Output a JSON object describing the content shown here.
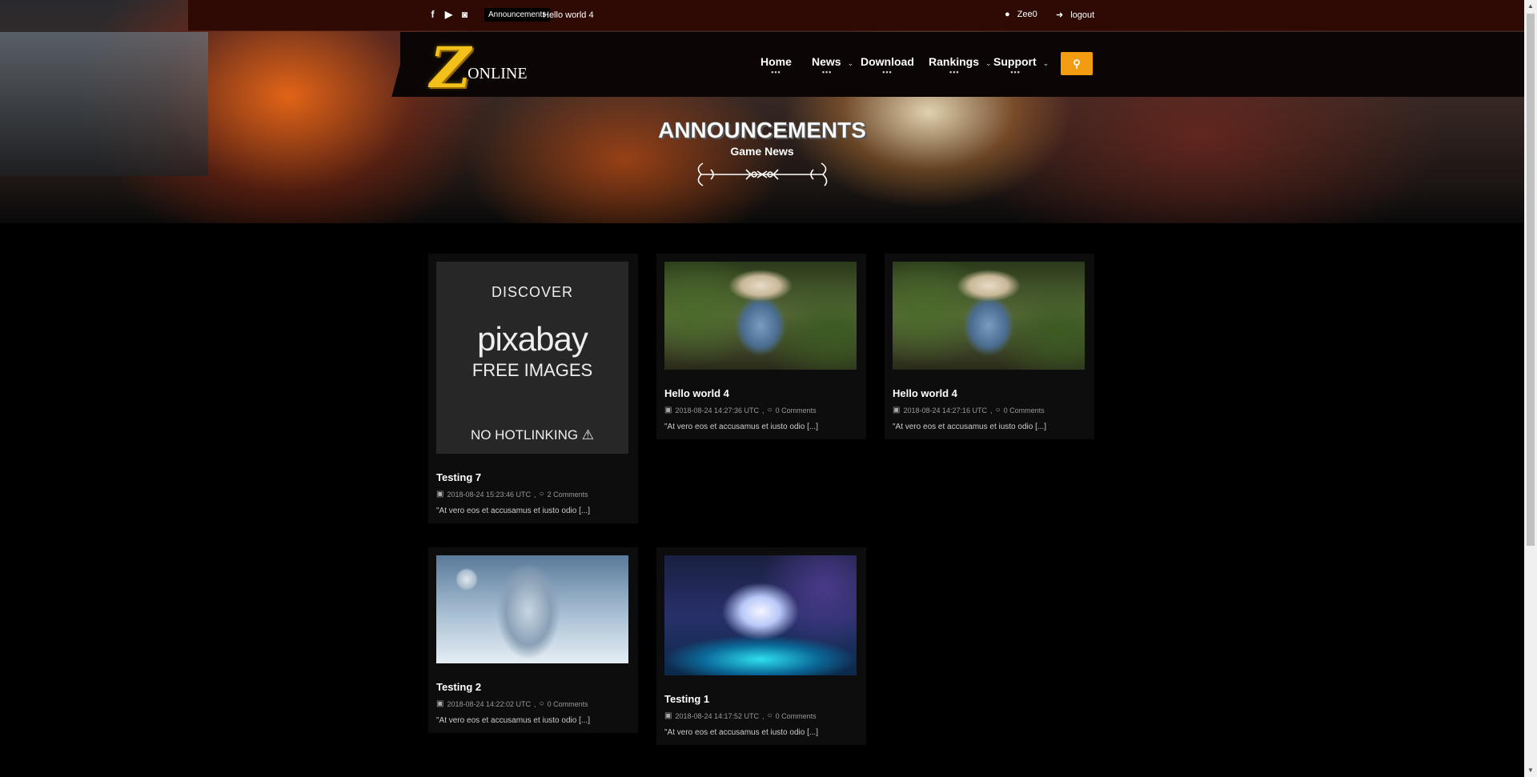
{
  "topbar": {
    "social_icons": [
      "facebook-icon",
      "youtube-icon",
      "discord-icon"
    ],
    "social_glyphs": [
      "f",
      "▶",
      "◙"
    ],
    "announcement_badge": "Announcements",
    "announcement_text": "Hello world 4",
    "username": "Zee0",
    "logout": "logout"
  },
  "logo": {
    "letter": "Z",
    "text": "ONLINE"
  },
  "nav": {
    "items": [
      {
        "label": "Home",
        "has_dropdown": false
      },
      {
        "label": "News",
        "has_dropdown": true
      },
      {
        "label": "Download",
        "has_dropdown": false
      },
      {
        "label": "Rankings",
        "has_dropdown": true
      },
      {
        "label": "Support",
        "has_dropdown": true
      }
    ],
    "dots": "•••",
    "caret": "⌄"
  },
  "page": {
    "title": "ANNOUNCEMENTS",
    "subtitle": "Game News"
  },
  "posts": [
    {
      "title": "Testing 7",
      "date": "2018-08-24 15:23:46 UTC",
      "comments": "2 Comments",
      "excerpt": "\"At vero eos et accusamus et iusto odio [...]",
      "image": "pixabay",
      "pixabay": {
        "line1": "DISCOVER",
        "line2": "pixabay",
        "line3": "FREE IMAGES",
        "line4": "NO HOTLINKING ⚠"
      }
    },
    {
      "title": "Hello world 4",
      "date": "2018-08-24 14:27:36 UTC",
      "comments": "0 Comments",
      "excerpt": "\"At vero eos et accusamus et iusto odio [...]",
      "image": "smurf"
    },
    {
      "title": "Hello world 4",
      "date": "2018-08-24 14:27:16 UTC",
      "comments": "0 Comments",
      "excerpt": "\"At vero eos et accusamus et iusto odio [...]",
      "image": "smurf"
    },
    {
      "title": "Testing 2",
      "date": "2018-08-24 14:22:02 UTC",
      "comments": "0 Comments",
      "excerpt": "\"At vero eos et accusamus et iusto odio [...]",
      "image": "snow"
    },
    {
      "title": "Testing 1",
      "date": "2018-08-24 14:17:52 UTC",
      "comments": "0 Comments",
      "excerpt": "\"At vero eos et accusamus et iusto odio [...]",
      "image": "unicorn"
    }
  ],
  "meta_separator": ",",
  "colors": {
    "topbar": "#2f0a04",
    "accent": "#f39c12",
    "logo": "#f3c21a"
  }
}
